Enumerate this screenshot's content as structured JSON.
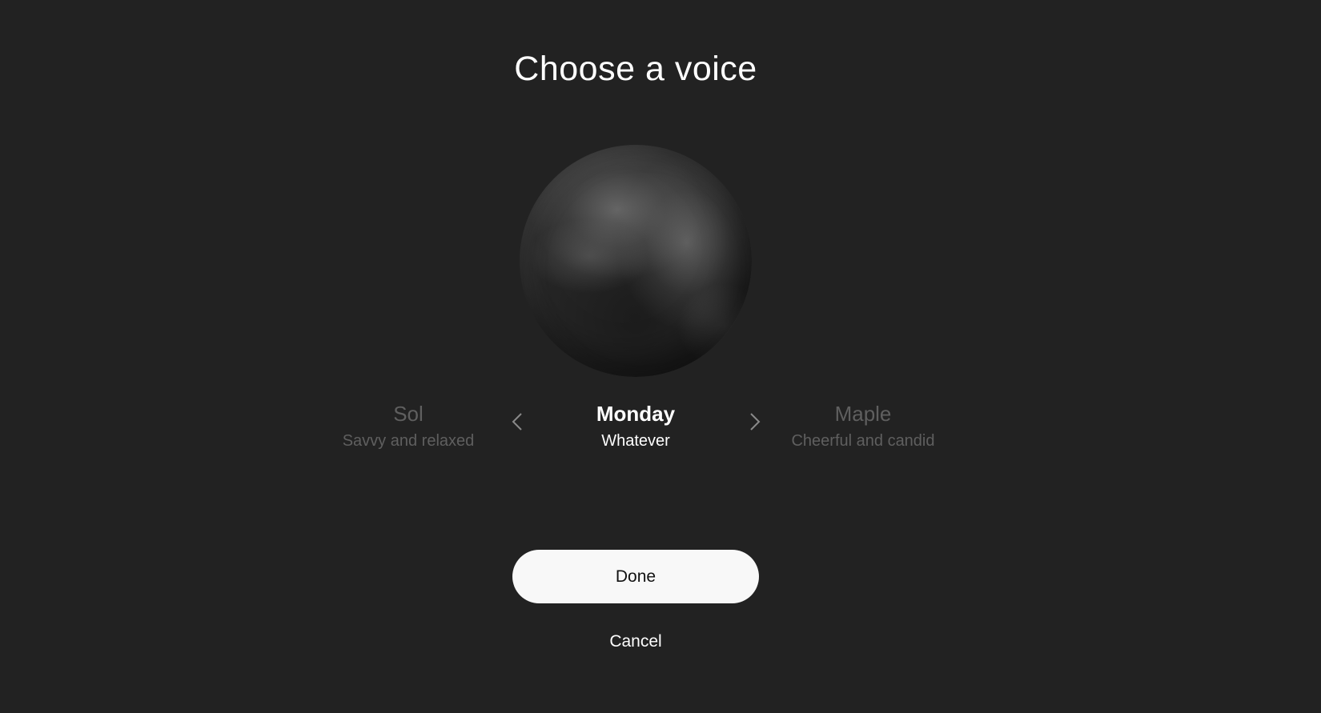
{
  "dialog": {
    "title": "Choose a voice"
  },
  "voices": [
    {
      "name": "Sol",
      "description": "Savvy and relaxed",
      "state": "previous"
    },
    {
      "name": "Monday",
      "description": "Whatever",
      "state": "selected"
    },
    {
      "name": "Maple",
      "description": "Cheerful and candid",
      "state": "next"
    }
  ],
  "icons": {
    "previous": "chevron-left-icon",
    "next": "chevron-right-icon",
    "orb": "voice-orb"
  },
  "actions": {
    "done_label": "Done",
    "cancel_label": "Cancel"
  },
  "colors": {
    "background": "#222222",
    "primary_text": "#ffffff",
    "dimmed_text": "#5f5f5f",
    "button_bg": "#f8f8f8",
    "button_text": "#111111"
  }
}
